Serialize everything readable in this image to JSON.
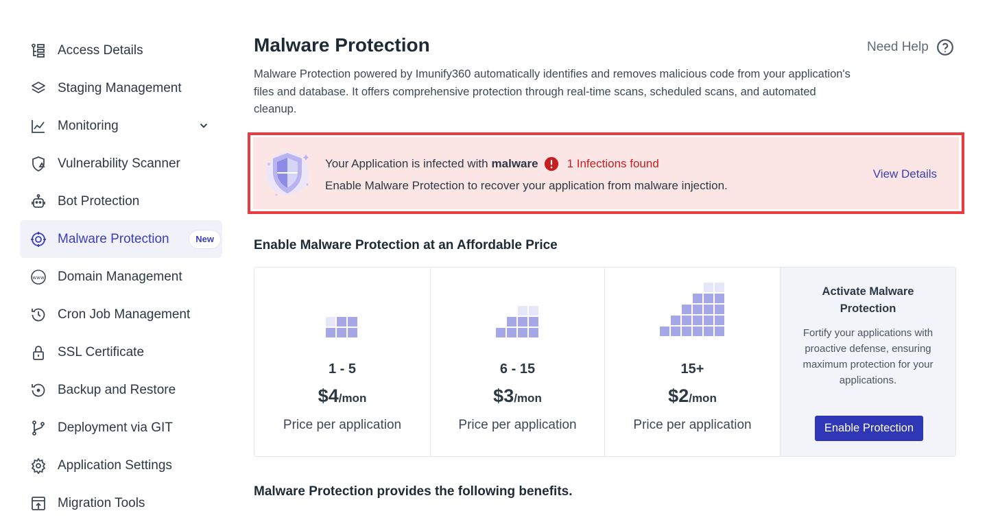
{
  "sidebar": {
    "items": [
      {
        "label": "Access Details",
        "icon": "access-details-icon"
      },
      {
        "label": "Staging Management",
        "icon": "layers-icon"
      },
      {
        "label": "Monitoring",
        "icon": "chart-line-icon",
        "expandable": true
      },
      {
        "label": "Vulnerability Scanner",
        "icon": "shield-warning-icon"
      },
      {
        "label": "Bot Protection",
        "icon": "bot-icon"
      },
      {
        "label": "Malware Protection",
        "icon": "virus-target-icon",
        "active": true,
        "badge": "New"
      },
      {
        "label": "Domain Management",
        "icon": "www-icon"
      },
      {
        "label": "Cron Job Management",
        "icon": "history-clock-icon"
      },
      {
        "label": "SSL Certificate",
        "icon": "lock-icon"
      },
      {
        "label": "Backup and Restore",
        "icon": "restore-icon"
      },
      {
        "label": "Deployment via GIT",
        "icon": "git-branch-icon"
      },
      {
        "label": "Application Settings",
        "icon": "gear-icon"
      },
      {
        "label": "Migration Tools",
        "icon": "migration-icon"
      }
    ]
  },
  "header": {
    "title": "Malware Protection",
    "help_label": "Need Help",
    "description": "Malware Protection powered by Imunify360 automatically identifies and removes malicious code from your application's files and database. It offers comprehensive protection through real-time scans, scheduled scans, and automated cleanup."
  },
  "alert": {
    "prefix": "Your Application is infected with",
    "emphasis": "malware",
    "infections": "1 Infections found",
    "message": "Enable Malware Protection to recover your application from malware injection.",
    "action_label": "View Details"
  },
  "pricing": {
    "section_title": "Enable Malware Protection at an Affordable Price",
    "tiers": [
      {
        "range": "1 - 5",
        "price": "$4",
        "unit": "/mon",
        "description": "Price per application"
      },
      {
        "range": "6 - 15",
        "price": "$3",
        "unit": "/mon",
        "description": "Price per application"
      },
      {
        "range": "15+",
        "price": "$2",
        "unit": "/mon",
        "description": "Price per application"
      }
    ],
    "activate": {
      "title": "Activate Malware Protection",
      "description": "Fortify your applications with proactive defense, ensuring maximum protection for your applications.",
      "button_label": "Enable Protection"
    }
  },
  "benefits": {
    "title": "Malware Protection provides the following benefits."
  },
  "colors": {
    "accent": "#3037b6",
    "alert_border": "#ea3b41",
    "alert_bg": "#fbe6e5",
    "danger_text": "#c81e1e",
    "active_bg": "#f1f2f9",
    "block_filled": "#a5a7e6",
    "block_light": "#e5e6f8"
  }
}
